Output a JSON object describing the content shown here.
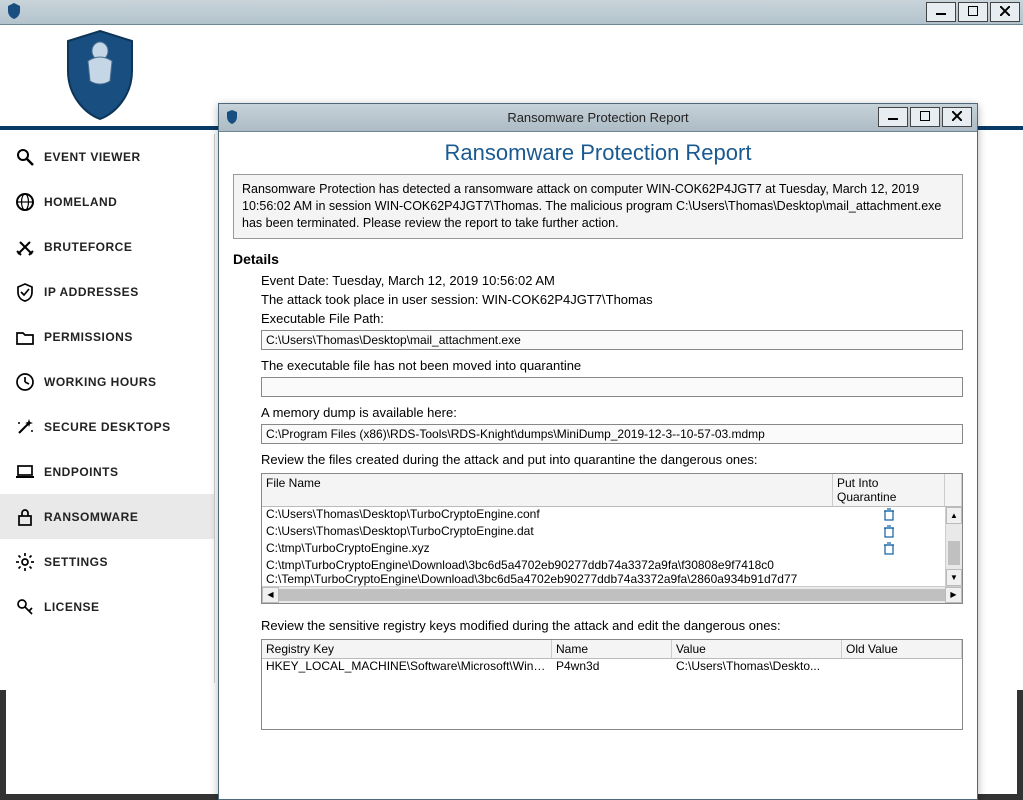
{
  "sidebar": {
    "items": [
      {
        "label": "EVENT VIEWER",
        "icon": "search"
      },
      {
        "label": "HOMELAND",
        "icon": "globe"
      },
      {
        "label": "BRUTEFORCE",
        "icon": "swords"
      },
      {
        "label": "IP ADDRESSES",
        "icon": "shield-check"
      },
      {
        "label": "PERMISSIONS",
        "icon": "folder"
      },
      {
        "label": "WORKING HOURS",
        "icon": "clock"
      },
      {
        "label": "SECURE DESKTOPS",
        "icon": "wand"
      },
      {
        "label": "ENDPOINTS",
        "icon": "laptop"
      },
      {
        "label": "RANSOMWARE",
        "icon": "lock"
      },
      {
        "label": "SETTINGS",
        "icon": "gear"
      },
      {
        "label": "LICENSE",
        "icon": "key"
      }
    ],
    "active_index": 8
  },
  "report": {
    "window_title": "Ransomware Protection Report",
    "heading": "Ransomware Protection Report",
    "alert": "Ransomware Protection has detected a ransomware attack on computer WIN-COK62P4JGT7 at Tuesday, March 12, 2019 10:56:02 AM in session WIN-COK62P4JGT7\\Thomas. The malicious program C:\\Users\\Thomas\\Desktop\\mail_attachment.exe has been terminated. Please review the report to take further action.",
    "details_heading": "Details",
    "event_date_line": "Event Date: Tuesday, March 12, 2019 10:56:02 AM",
    "session_line": "The attack took place in user session: WIN-COK62P4JGT7\\Thomas",
    "exe_label": "Executable File Path:",
    "exe_path": "C:\\Users\\Thomas\\Desktop\\mail_attachment.exe",
    "quarantine_status": "The executable file has not been moved into quarantine",
    "dump_label": "A memory dump is available here:",
    "dump_path": "C:\\Program Files (x86)\\RDS-Tools\\RDS-Knight\\dumps\\MiniDump_2019-12-3--10-57-03.mdmp",
    "files_review_label": "Review the files created during the attack and put into quarantine the dangerous ones:",
    "file_table": {
      "col_name": "File Name",
      "col_q": "Put Into Quarantine",
      "rows": [
        {
          "name": "C:\\Users\\Thomas\\Desktop\\TurboCryptoEngine.conf",
          "quarantine": true
        },
        {
          "name": "C:\\Users\\Thomas\\Desktop\\TurboCryptoEngine.dat",
          "quarantine": true
        },
        {
          "name": "C:\\tmp\\TurboCryptoEngine.xyz",
          "quarantine": true
        },
        {
          "name": "C:\\tmp\\TurboCryptoEngine\\Download\\3bc6d5a4702eb90277ddb74a3372a9fa\\f30808e9f7418c0",
          "quarantine": false
        },
        {
          "name": "C:\\Temp\\TurboCryptoEngine\\Download\\3bc6d5a4702eb90277ddb74a3372a9fa\\2860a934b91d7d77",
          "quarantine": false
        }
      ]
    },
    "registry_review_label": "Review the sensitive registry keys modified during the attack and edit the dangerous ones:",
    "reg_table": {
      "col_key": "Registry Key",
      "col_name": "Name",
      "col_value": "Value",
      "col_old": "Old Value",
      "rows": [
        {
          "key": "HKEY_LOCAL_MACHINE\\Software\\Microsoft\\Windows\\...",
          "name": "P4wn3d",
          "value": "C:\\Users\\Thomas\\Deskto...",
          "old": ""
        }
      ]
    }
  }
}
